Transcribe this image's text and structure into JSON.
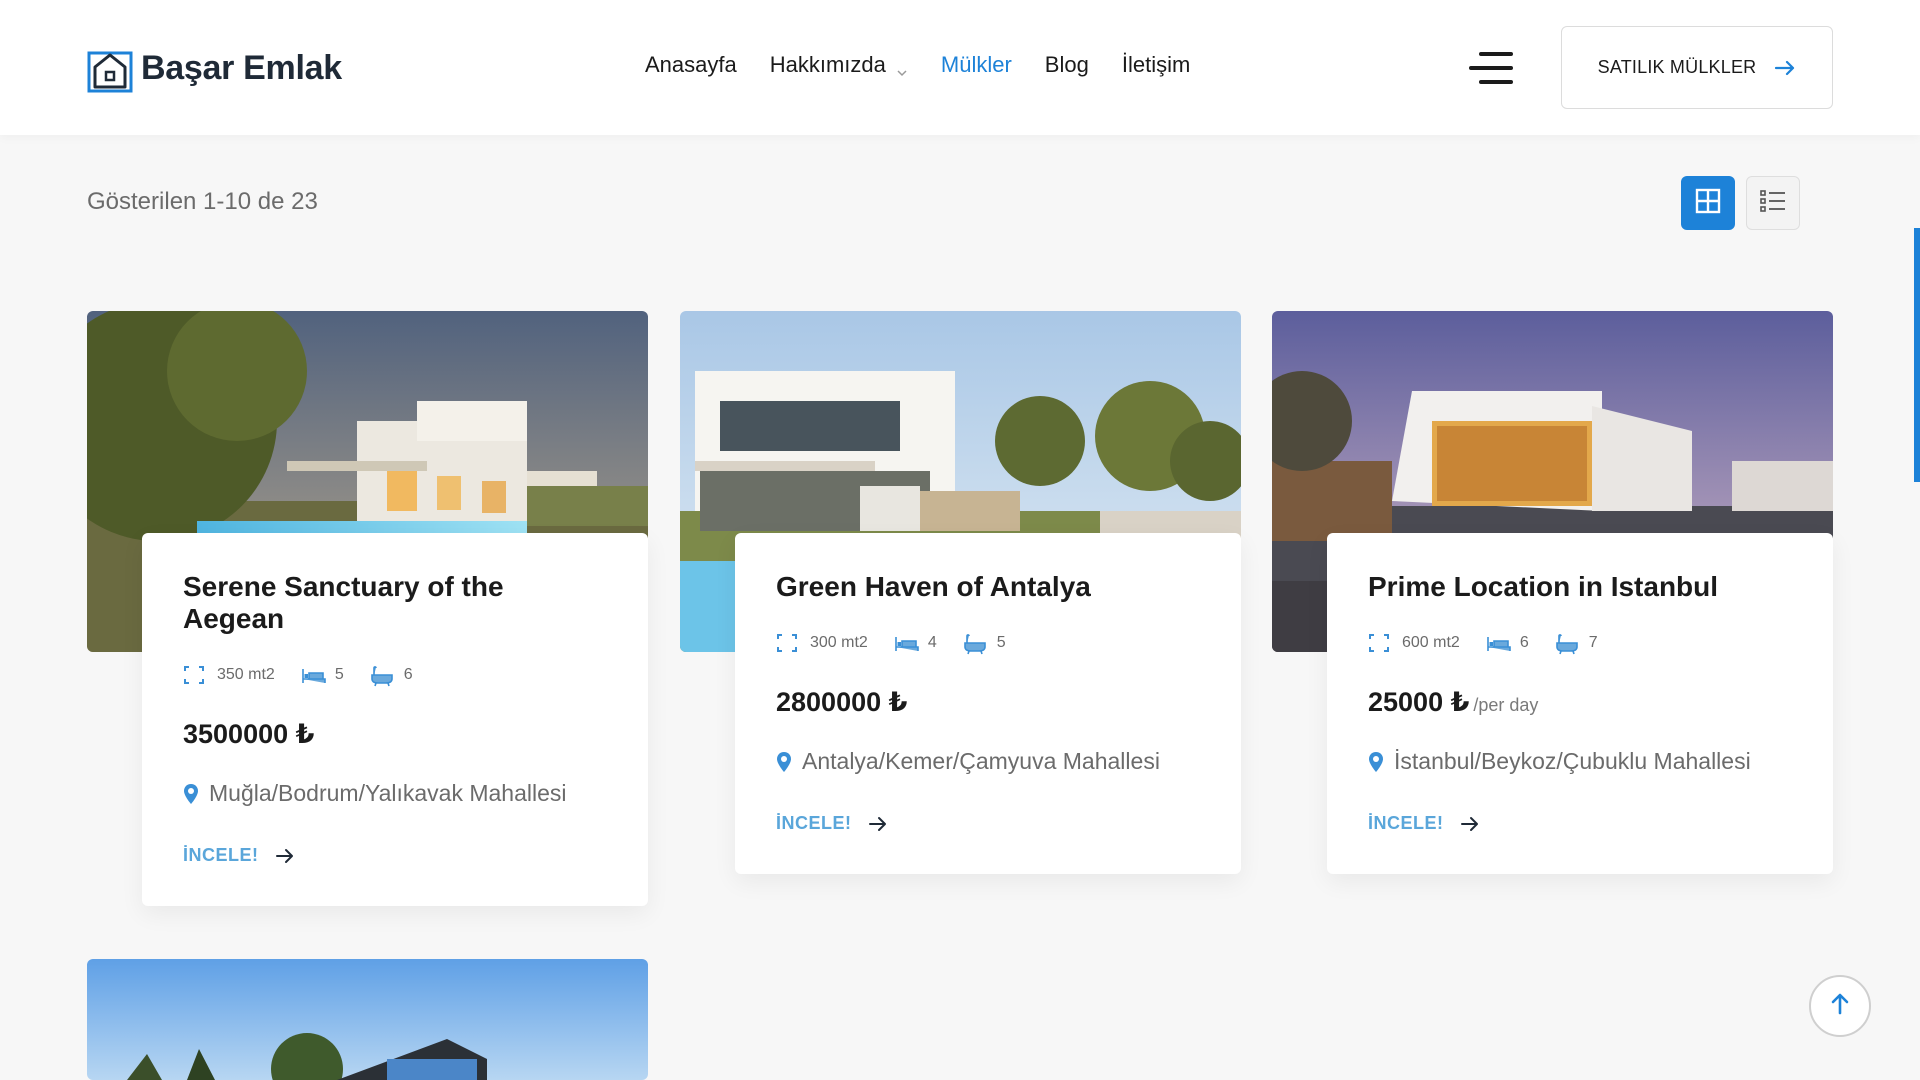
{
  "header": {
    "brand": "Başar Emlak",
    "nav": [
      {
        "label": "Anasayfa",
        "active": false,
        "dropdown": false
      },
      {
        "label": "Hakkımızda",
        "active": false,
        "dropdown": true
      },
      {
        "label": "Mülkler",
        "active": true,
        "dropdown": false
      },
      {
        "label": "Blog",
        "active": false,
        "dropdown": false
      },
      {
        "label": "İletişim",
        "active": false,
        "dropdown": false
      }
    ],
    "cta_label": "SATILIK MÜLKLER"
  },
  "toolbar": {
    "results_text": "Gösterilen 1-10 de 23",
    "views": [
      "grid",
      "list"
    ],
    "active_view": "grid"
  },
  "listings": [
    {
      "title": "Serene Sanctuary of the Aegean",
      "area": "350 mt2",
      "bedrooms": "5",
      "bathrooms": "6",
      "price": "3500000 ₺",
      "price_suffix": "",
      "location": "Muğla/Bodrum/Yalıkavak Mahallesi",
      "cta": "İNCELE!"
    },
    {
      "title": "Green Haven of Antalya",
      "area": "300 mt2",
      "bedrooms": "4",
      "bathrooms": "5",
      "price": "2800000 ₺",
      "price_suffix": "",
      "location": "Antalya/Kemer/Çamyuva Mahallesi",
      "cta": "İNCELE!"
    },
    {
      "title": "Prime Location in Istanbul",
      "area": "600 mt2",
      "bedrooms": "6",
      "bathrooms": "7",
      "price": "25000 ₺",
      "price_suffix": "/per day",
      "location": "İstanbul/Beykoz/Çubuklu Mahallesi",
      "cta": "İNCELE!"
    }
  ],
  "colors": {
    "accent": "#1d82d8",
    "link": "#5aa6da",
    "text": "#1b1b1b",
    "muted": "#6b6b6b",
    "background": "#f7f7f7"
  },
  "icons": {
    "brand": "house-logo-icon",
    "menu": "hamburger-icon",
    "cta": "arrow-right-icon",
    "area": "area-icon",
    "bed": "bed-icon",
    "bath": "bathtub-icon",
    "location": "map-pin-icon",
    "back_to_top": "arrow-up-icon"
  }
}
